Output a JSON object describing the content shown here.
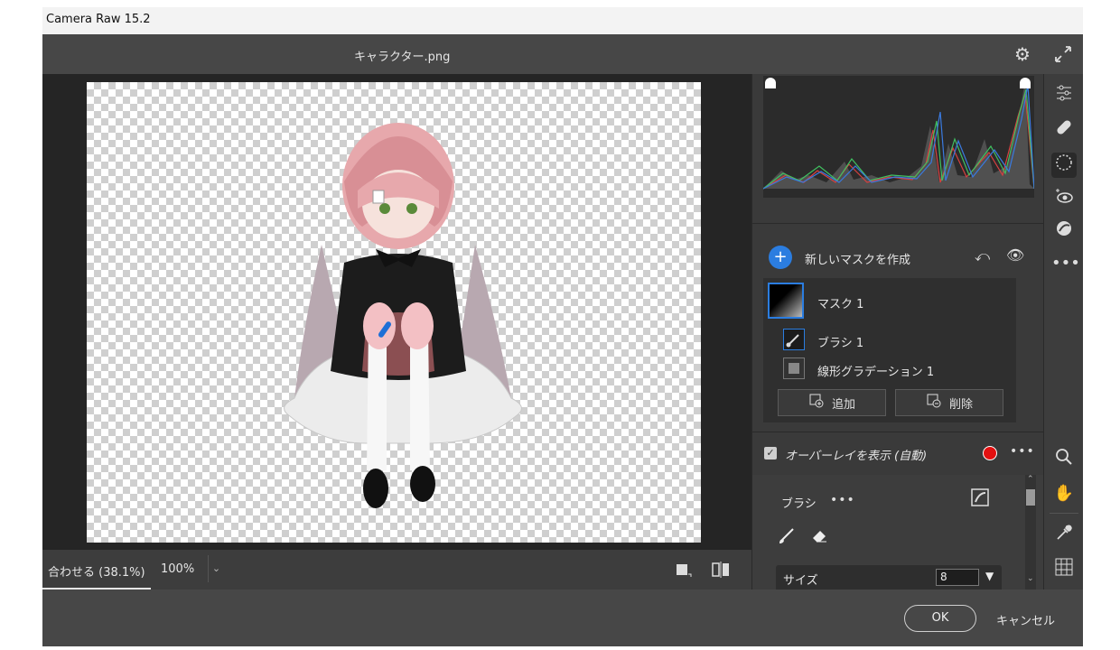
{
  "window": {
    "title": "Camera Raw 15.2"
  },
  "header": {
    "filename": "キャラクター.png",
    "settings_icon": "gear-icon",
    "fullscreen_icon": "expand-icon"
  },
  "canvas": {
    "zoom_fit_label": "合わせる (38.1%)",
    "zoom_100_label": "100%",
    "zoom_dropdown": "⌄"
  },
  "mask_panel": {
    "new_mask_label": "新しいマスクを作成",
    "mask_name": "マスク 1",
    "components": [
      {
        "label": "ブラシ 1",
        "icon": "brush-icon"
      },
      {
        "label": "線形グラデーション 1",
        "icon": "linear-gradient-icon"
      }
    ],
    "add_label": "追加",
    "delete_label": "削除"
  },
  "overlay": {
    "label": "オーバーレイを表示 (自動)",
    "checked": true,
    "color": "#e31010"
  },
  "brush": {
    "title": "ブラシ",
    "size_label": "サイズ",
    "size_value": "8"
  },
  "footer": {
    "ok_label": "OK",
    "cancel_label": "キャンセル"
  },
  "colors": {
    "accent": "#2b7de0",
    "overlay": "#e31010"
  }
}
